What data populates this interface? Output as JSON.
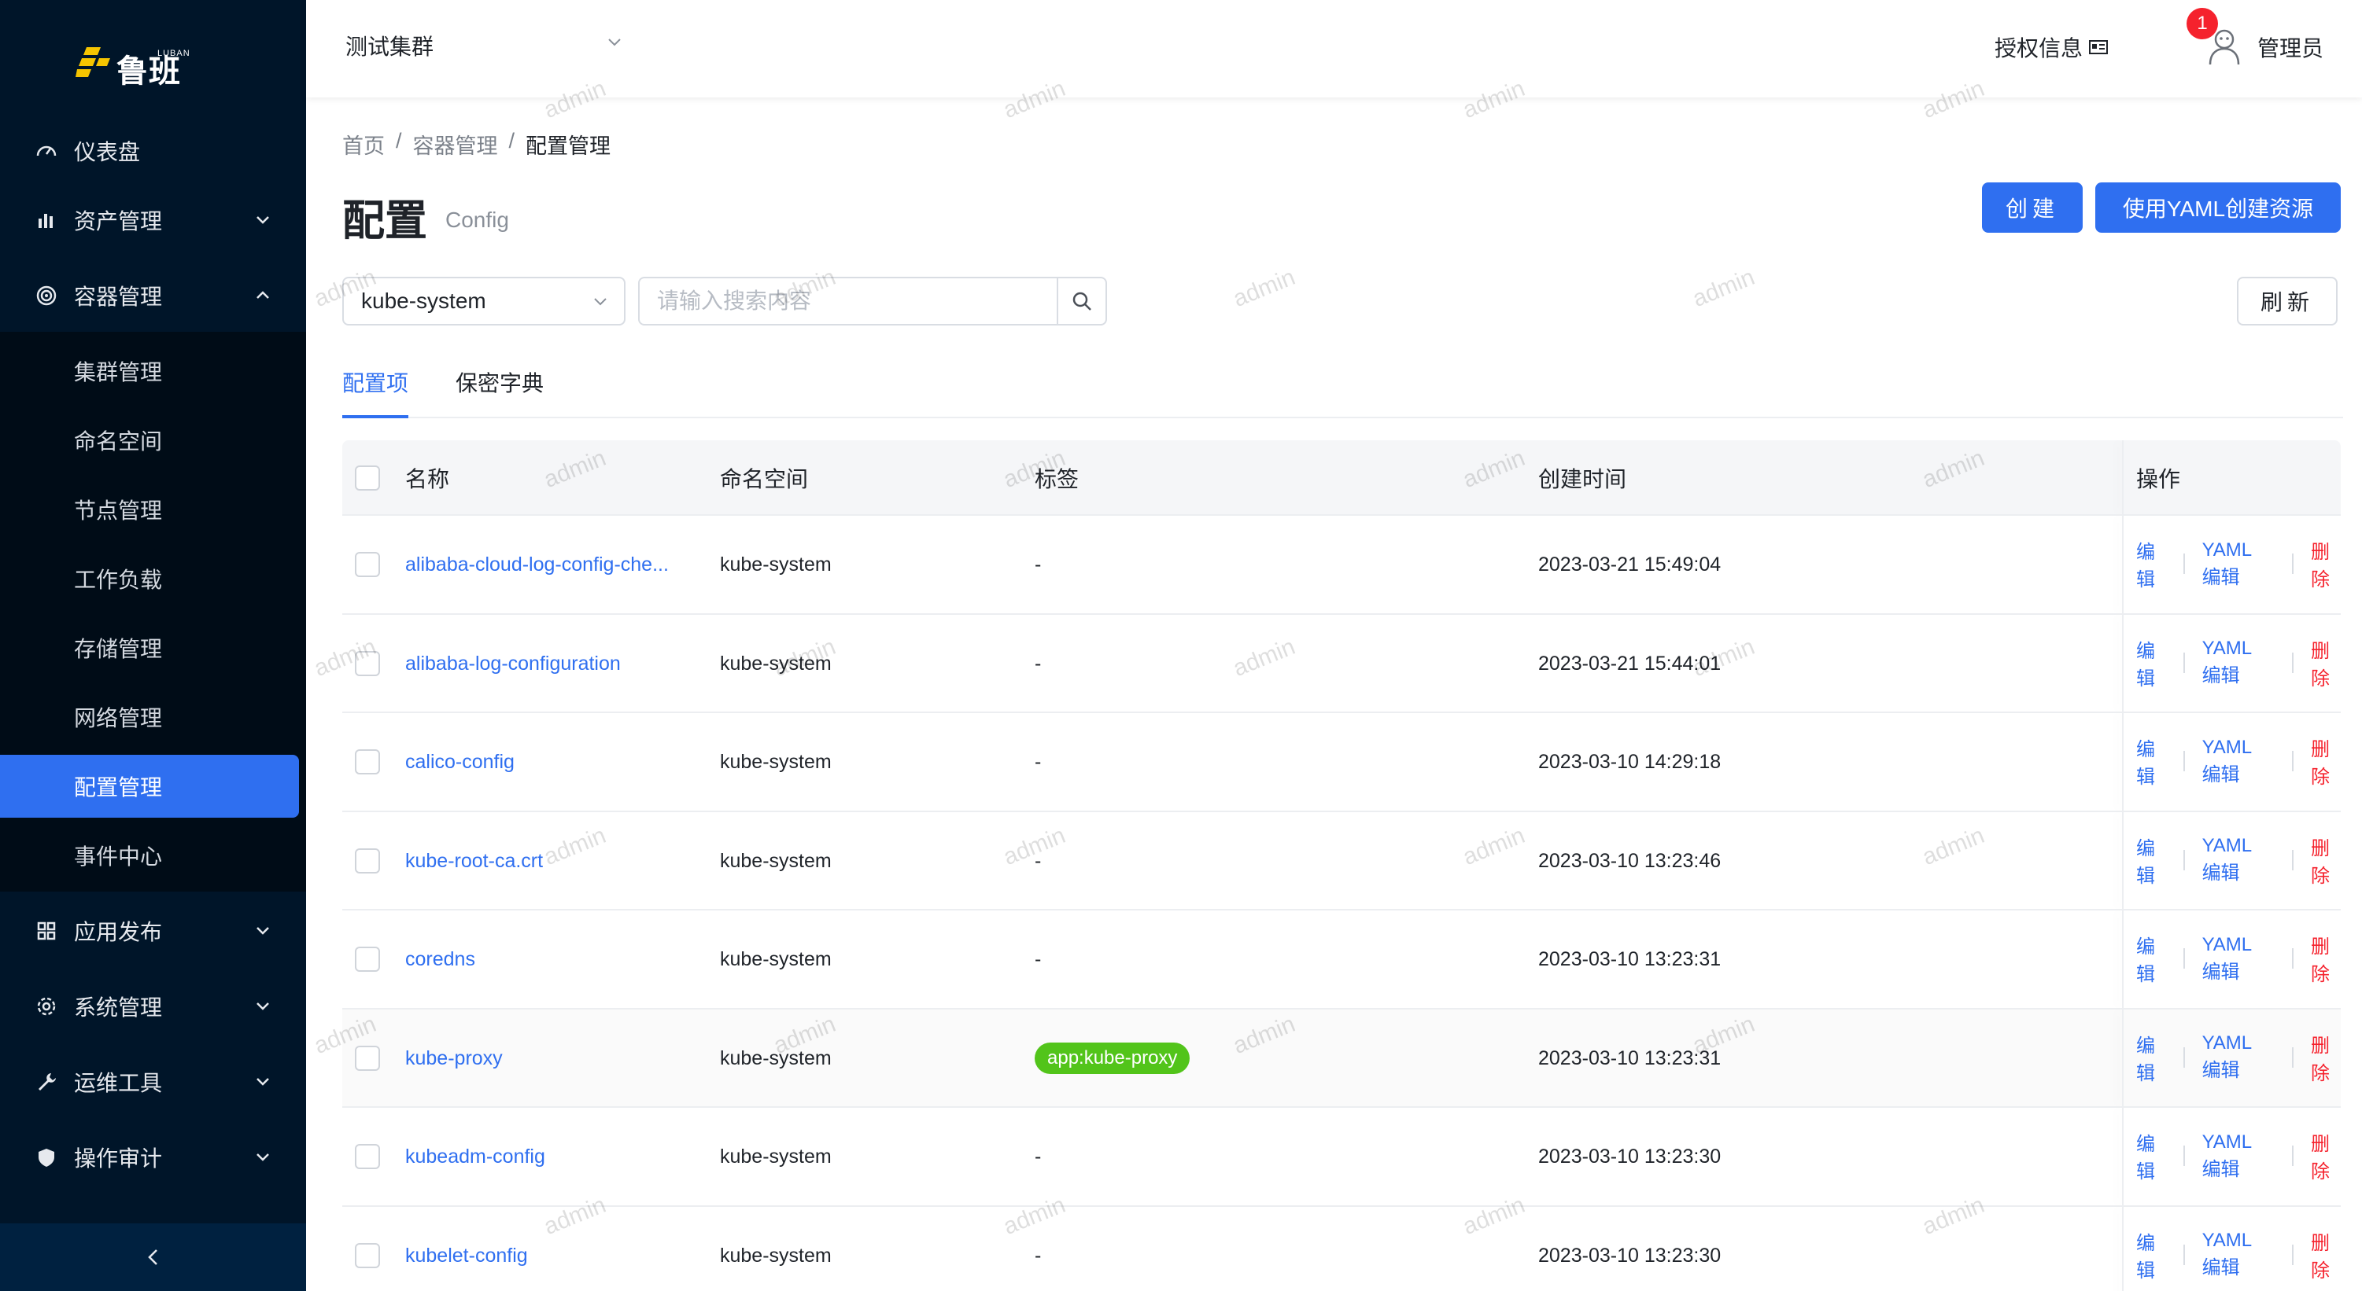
{
  "brand": {
    "name": "鲁班",
    "sub": "LUBAN"
  },
  "sidebar": {
    "items": [
      {
        "label": "仪表盘",
        "icon": "dashboard-icon"
      },
      {
        "label": "资产管理",
        "icon": "bar-chart-icon"
      },
      {
        "label": "容器管理",
        "icon": "container-icon"
      },
      {
        "label": "应用发布",
        "icon": "appstore-icon"
      },
      {
        "label": "系统管理",
        "icon": "settings-icon"
      },
      {
        "label": "运维工具",
        "icon": "tool-icon"
      },
      {
        "label": "操作审计",
        "icon": "shield-icon"
      }
    ],
    "submenu": [
      "集群管理",
      "命名空间",
      "节点管理",
      "工作负载",
      "存储管理",
      "网络管理",
      "配置管理",
      "事件中心"
    ],
    "active_sub": "配置管理"
  },
  "header": {
    "cluster": "测试集群",
    "auth_info": "授权信息",
    "notification_count": "1",
    "user": "管理员"
  },
  "breadcrumb": [
    "首页",
    "/",
    "容器管理",
    "/",
    "配置管理"
  ],
  "page": {
    "title": "配置",
    "subtitle": "Config"
  },
  "toolbar": {
    "create_label": "创建",
    "yaml_label": "使用YAML创建资源",
    "namespace": "kube-system",
    "search_placeholder": "请输入搜索内容",
    "refresh_label": "刷新"
  },
  "tabs": [
    "配置项",
    "保密字典"
  ],
  "table": {
    "headers": [
      "名称",
      "命名空间",
      "标签",
      "创建时间",
      "操作"
    ],
    "ops": {
      "edit": "编辑",
      "yaml_edit": "YAML 编辑",
      "delete": "删除"
    },
    "rows": [
      {
        "name": "alibaba-cloud-log-config-che...",
        "namespace": "kube-system",
        "label": "-",
        "created": "2023-03-21 15:49:04"
      },
      {
        "name": "alibaba-log-configuration",
        "namespace": "kube-system",
        "label": "-",
        "created": "2023-03-21 15:44:01"
      },
      {
        "name": "calico-config",
        "namespace": "kube-system",
        "label": "-",
        "created": "2023-03-10 14:29:18"
      },
      {
        "name": "kube-root-ca.crt",
        "namespace": "kube-system",
        "label": "-",
        "created": "2023-03-10 13:23:46"
      },
      {
        "name": "coredns",
        "namespace": "kube-system",
        "label": "-",
        "created": "2023-03-10 13:23:31"
      },
      {
        "name": "kube-proxy",
        "namespace": "kube-system",
        "label": "app:kube-proxy",
        "created": "2023-03-10 13:23:31"
      },
      {
        "name": "kubeadm-config",
        "namespace": "kube-system",
        "label": "-",
        "created": "2023-03-10 13:23:30"
      },
      {
        "name": "kubelet-config",
        "namespace": "kube-system",
        "label": "-",
        "created": "2023-03-10 13:23:30"
      }
    ]
  },
  "watermark": "admin",
  "colors": {
    "sidebar": "#001529",
    "primary": "#2f6ff0",
    "danger": "#f5222d",
    "tag": "#52c41a"
  }
}
